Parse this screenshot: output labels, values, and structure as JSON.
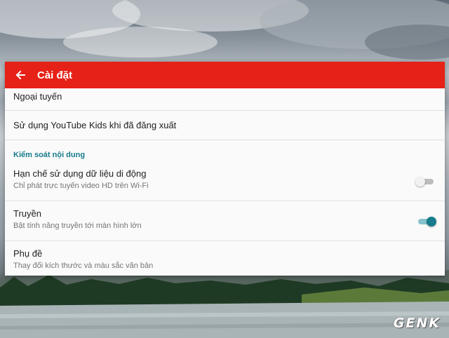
{
  "header": {
    "title": "Cài đặt"
  },
  "settings": {
    "offline_label": "Ngoại tuyến",
    "signout_label": "Sử dụng YouTube Kids khi đã đăng xuất",
    "section_content_control": "Kiểm soát nội dung",
    "mobile_data": {
      "title": "Hạn chế sử dụng dữ liệu di động",
      "subtitle": "Chỉ phát trực tuyến video HD trên Wi-Fi",
      "enabled": false
    },
    "cast": {
      "title": "Truyền",
      "subtitle": "Bật tính năng truyền tới màn hình lớn",
      "enabled": true
    },
    "captions": {
      "title": "Phụ đề",
      "subtitle": "Thay đổi kích thước và màu sắc văn bản"
    }
  },
  "watermark": "GENK",
  "colors": {
    "appbar": "#e62117",
    "accent": "#167b8c",
    "panel_bg": "#fafafa"
  },
  "icons": {
    "back": "arrow-back-icon"
  }
}
